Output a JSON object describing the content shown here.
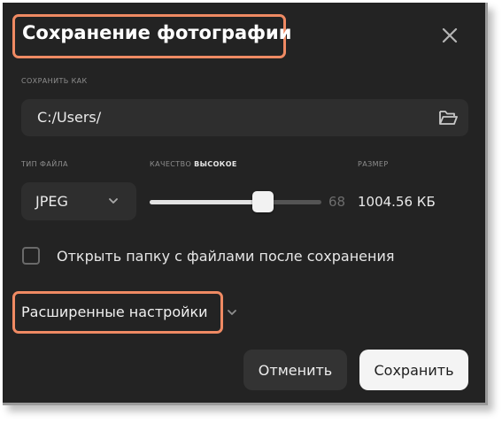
{
  "dialog": {
    "title": "Сохранение фотографии",
    "save_as_label": "СОХРАНИТЬ КАК",
    "path_value": "C:/Users/",
    "file_type_label": "ТИП ФАЙЛА",
    "file_type_value": "JPEG",
    "quality_label": "КАЧЕСТВО",
    "quality_level": "ВЫСОКОЕ",
    "quality_value": "68",
    "quality_percent": 68,
    "size_label": "РАЗМЕР",
    "size_value": "1004.56 КБ",
    "open_folder_label": "Открыть папку с файлами после сохранения",
    "open_folder_checked": false,
    "advanced_label": "Расширенные настройки",
    "cancel_label": "Отменить",
    "save_label": "Сохранить"
  },
  "colors": {
    "background": "#232323",
    "field": "#2e2e2e",
    "highlight": "#ef8a63",
    "primary_button": "#f4f4f4"
  },
  "icons": [
    "close-icon",
    "folder-open-icon",
    "chevron-down-icon"
  ]
}
